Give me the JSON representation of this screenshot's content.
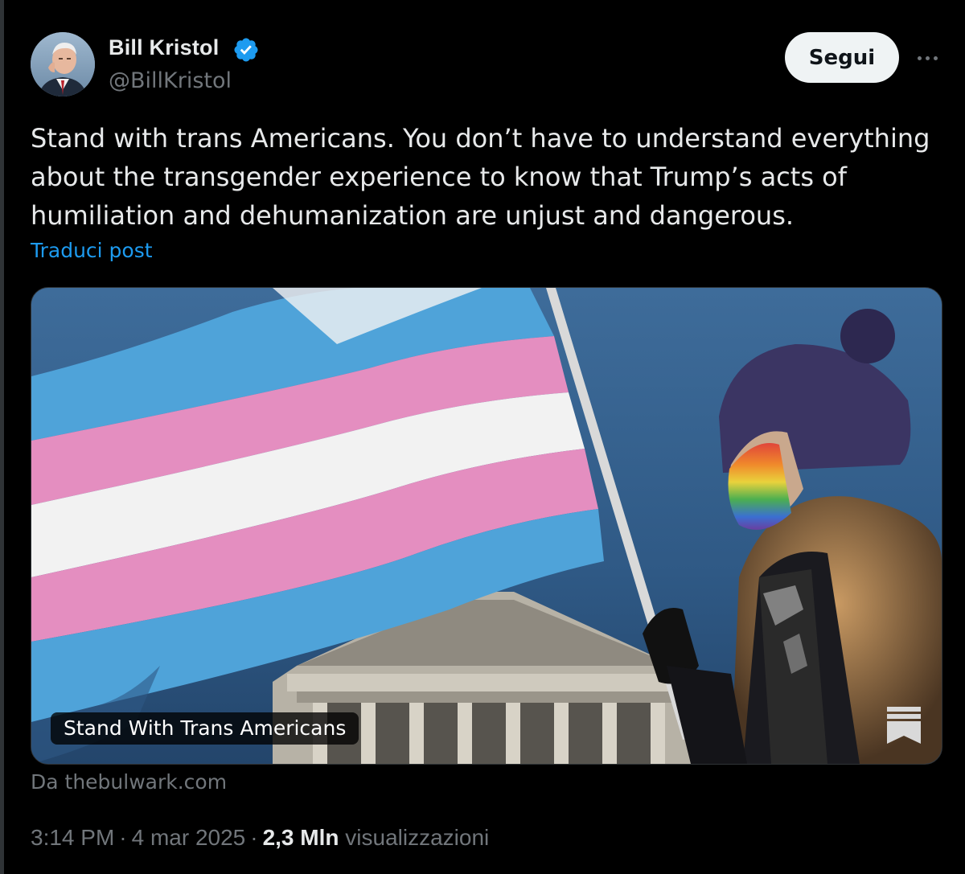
{
  "author": {
    "name": "Bill Kristol",
    "handle": "@BillKristol",
    "verified_icon": "verified-badge-icon",
    "avatar_icon": "avatar"
  },
  "actions": {
    "follow_label": "Segui",
    "more_icon": "more-icon"
  },
  "tweet": {
    "text": "Stand with trans Americans. You don’t have to understand everything about the transgender experience to know that Trump’s acts of humiliation and dehumanization are unjust and dangerous.",
    "translate_label": "Traduci post"
  },
  "card": {
    "title": "Stand With Trans Americans",
    "source": "Da thebulwark.com",
    "logo_icon": "bulwark-logo-icon"
  },
  "meta": {
    "time": "3:14 PM",
    "date": "4 mar 2025",
    "separator": "·",
    "views_count": "2,3 Mln",
    "views_label": "visualizzazioni"
  },
  "colors": {
    "background": "#000000",
    "text_primary": "#e7e9ea",
    "text_secondary": "#71767b",
    "link": "#1d9bf0",
    "verified": "#1d9bf0",
    "flag_pink": "#e48ec0",
    "flag_blue": "#4fa3d9",
    "flag_white": "#f2f2f2"
  }
}
